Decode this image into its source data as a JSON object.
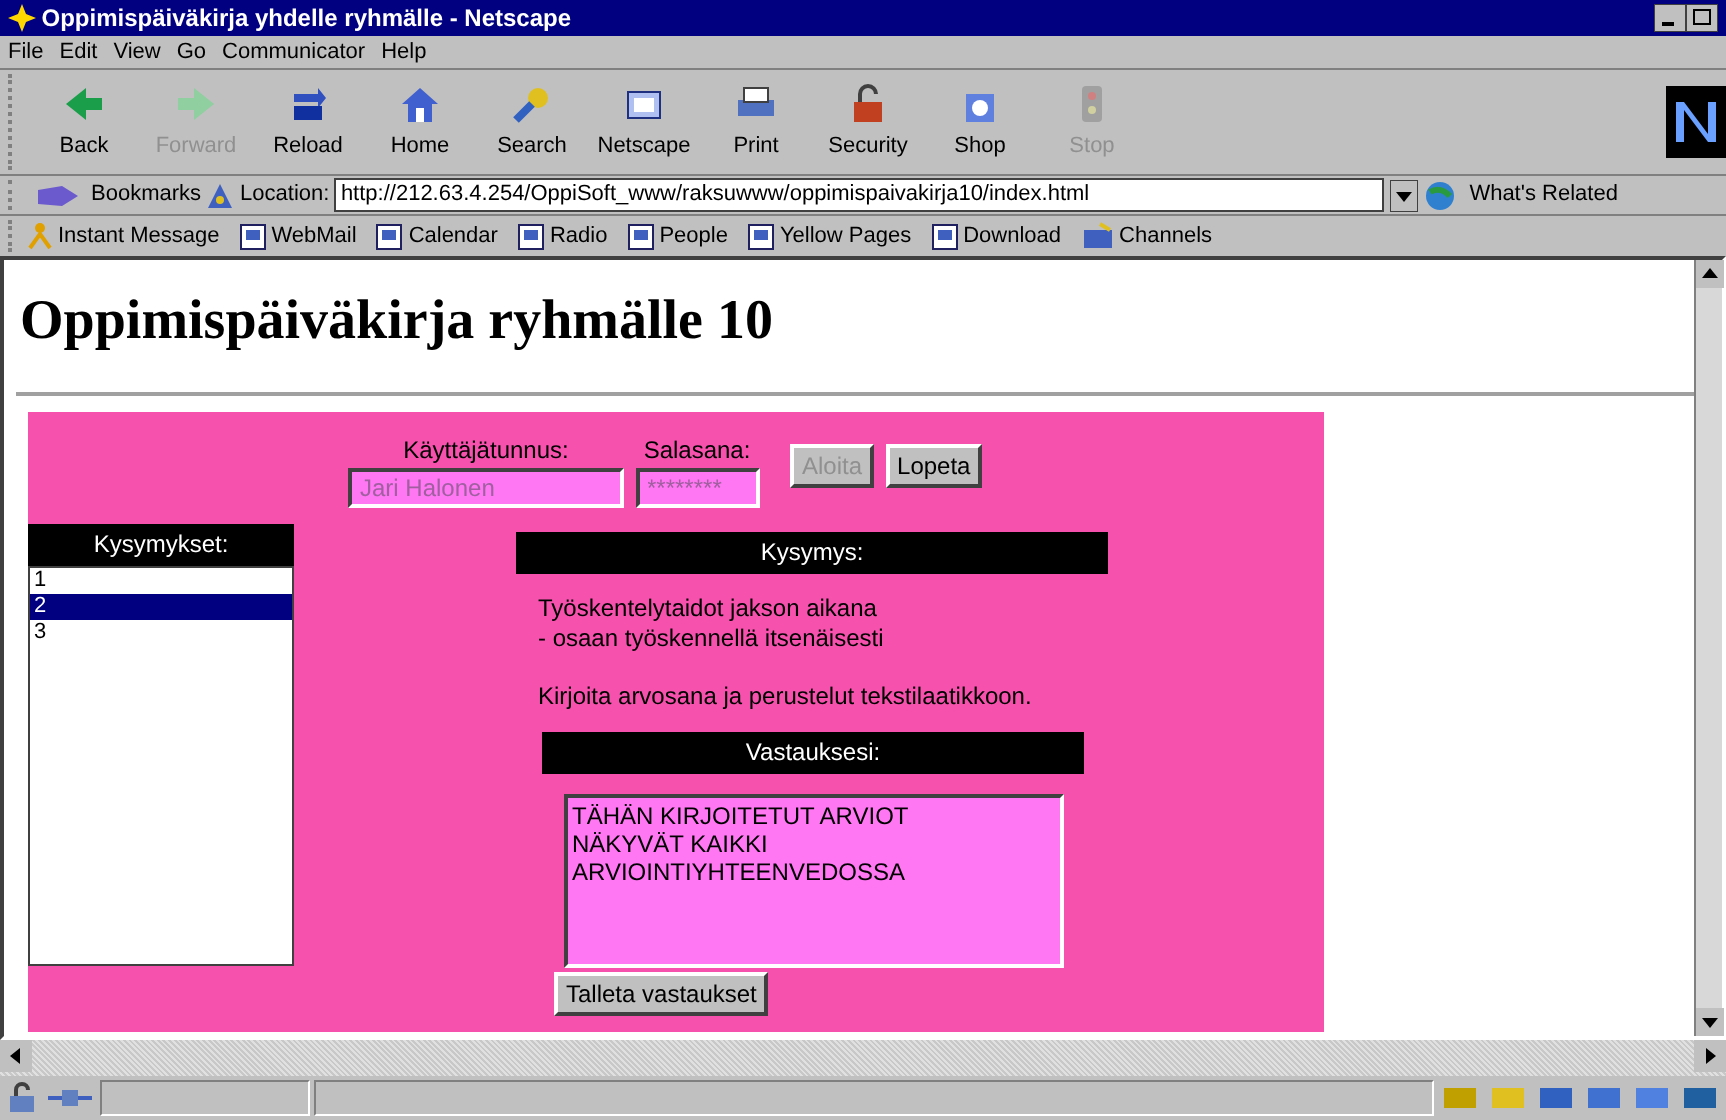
{
  "window": {
    "title": "Oppimispäiväkirja yhdelle ryhmälle - Netscape"
  },
  "menu": [
    "File",
    "Edit",
    "View",
    "Go",
    "Communicator",
    "Help"
  ],
  "toolbar": [
    {
      "label": "Back",
      "disabled": false
    },
    {
      "label": "Forward",
      "disabled": true
    },
    {
      "label": "Reload",
      "disabled": false
    },
    {
      "label": "Home",
      "disabled": false
    },
    {
      "label": "Search",
      "disabled": false
    },
    {
      "label": "Netscape",
      "disabled": false
    },
    {
      "label": "Print",
      "disabled": false
    },
    {
      "label": "Security",
      "disabled": false
    },
    {
      "label": "Shop",
      "disabled": false
    },
    {
      "label": "Stop",
      "disabled": true
    }
  ],
  "location_bar": {
    "bookmarks": "Bookmarks",
    "label": "Location:",
    "url": "http://212.63.4.254/OppiSoft_www/raksuwww/oppimispaivakirja10/index.html",
    "related": "What's Related"
  },
  "personal_toolbar": [
    "Instant Message",
    "WebMail",
    "Calendar",
    "Radio",
    "People",
    "Yellow Pages",
    "Download",
    "Channels"
  ],
  "page": {
    "heading": "Oppimispäiväkirja ryhmälle 10",
    "login": {
      "username_label": "Käyttäjätunnus:",
      "username": "Jari Halonen",
      "password_label": "Salasana:",
      "password": "********",
      "disabled": true
    },
    "buttons": [
      {
        "label": "Aloita",
        "disabled": true
      },
      {
        "label": "Lopeta",
        "disabled": false
      }
    ],
    "questions_header": "Kysymykset:",
    "questions": [
      {
        "label": "1",
        "selected": false
      },
      {
        "label": "2",
        "selected": true
      },
      {
        "label": "3",
        "selected": false
      }
    ],
    "question_header": "Kysymys:",
    "question_lines": [
      "Työskentelytaidot jakson aikana",
      "- osaan työskennellä itsenäisesti"
    ],
    "instruction": "Kirjoita arvosana ja perustelut tekstilaatikkoon.",
    "answer_header": "Vastauksesi:",
    "answer": "TÄHÄN KIRJOITETUT ARVIOT\nNÄKYVÄT KAIKKI\nARVIOINTIYHTEENVEDOSSA",
    "save_button": "Talleta vastaukset"
  }
}
